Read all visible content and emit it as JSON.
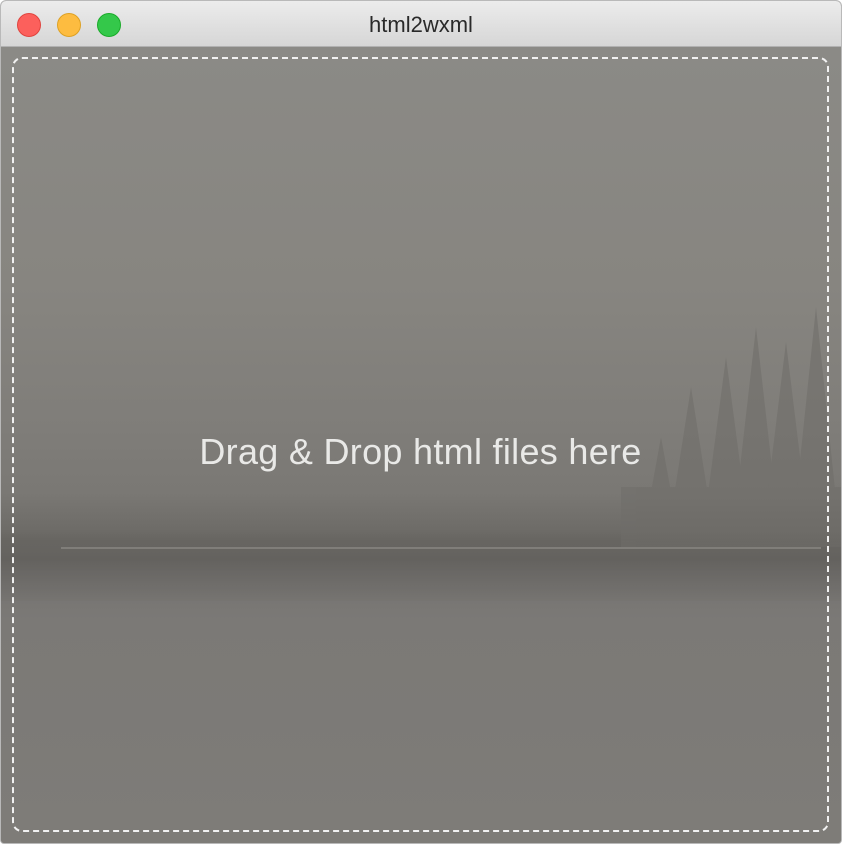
{
  "window": {
    "title": "html2wxml",
    "controls": {
      "close_icon": "close-icon",
      "minimize_icon": "minimize-icon",
      "zoom_icon": "zoom-icon",
      "close_color": "#fc605c",
      "minimize_color": "#fdbc40",
      "zoom_color": "#34c84a"
    }
  },
  "dropzone": {
    "text": "Drag & Drop html files here"
  }
}
